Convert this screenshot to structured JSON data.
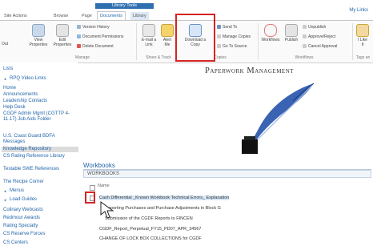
{
  "tabs": {
    "library_tools": "Library Tools",
    "site_actions": "Site Actions",
    "browse": "Browse",
    "page": "Page",
    "documents": "Documents",
    "library": "Library"
  },
  "user": "My Links",
  "ribbon": {
    "out": "Out",
    "view_properties": [
      "View",
      "Properties"
    ],
    "edit_properties": [
      "Edit",
      "Properties"
    ],
    "version_history": "Version History",
    "document_permissions": "Document Permissions",
    "delete_document": "Delete Document",
    "email_link": [
      "E-mail a",
      "Link"
    ],
    "alert_me": [
      "Alert",
      "Me"
    ],
    "download_copy": [
      "Download a",
      "Copy"
    ],
    "send_to": "Send To",
    "manage_copies": "Manage Copies",
    "go_to_source": "Go To Source",
    "workflows": "Workflows",
    "publish": "Publish",
    "unpublish": "Unpublish",
    "approve_reject": "Approve/Reject",
    "cancel_approval": "Cancel Approval",
    "i_like_it": [
      "I Like",
      "It"
    ],
    "groups": {
      "manage": "Manage",
      "share_track": "Share & Track",
      "copies": "Copies",
      "workflows": "Workflows",
      "tags": "Tags an"
    },
    "colors": {
      "accent": "#2f6fb0",
      "highlight": "#d42424"
    }
  },
  "leftnav": [
    {
      "label": "Lists",
      "type": "header"
    },
    {
      "label": "RPQ Video Links",
      "type": "sub"
    },
    {
      "label": "Home",
      "type": "item"
    },
    {
      "label": "Announcements",
      "type": "item"
    },
    {
      "label": "Leadership Contacts",
      "type": "item"
    },
    {
      "label": "Help Desk",
      "type": "item"
    },
    {
      "label": "CGDF Admin Mgmt (CGTTP 4-11.17) Job Aids Folder",
      "type": "item"
    },
    {
      "label": "U.S. Coast Guard BDFA Messages",
      "type": "item"
    },
    {
      "label": "Knowledge Repository",
      "type": "active"
    },
    {
      "label": "CS Rating Reference Library",
      "type": "item"
    },
    {
      "label": "Testable SWE References",
      "type": "item"
    },
    {
      "label": "The Recipe Corner",
      "type": "item"
    },
    {
      "label": "Menus",
      "type": "sub"
    },
    {
      "label": "Load Guides",
      "type": "sub"
    },
    {
      "label": "Culinary Webcasts",
      "type": "item"
    },
    {
      "label": "Redmour Awards",
      "type": "item"
    },
    {
      "label": "Rating Specialty",
      "type": "item"
    },
    {
      "label": "CS Reserve Forces",
      "type": "item"
    },
    {
      "label": "CS Centers",
      "type": "item"
    }
  ],
  "main": {
    "title": "Paperwork Management",
    "workbooks_heading": "Workbooks",
    "workbooks_box": "WORKBOOKS",
    "name_header": "Name",
    "rows": [
      "Cash Differential _Known Workbook Technical Errors_ Explanation",
      "Reporting Purchases and Purchase Adjustments in Block G",
      "Submission of the CGDF Reports to FINCEN",
      "CGDF_Report_Perpetual_FY15_PD07_APR_34567",
      "CHANGE OF LOCK BOX COLLECTIONS for CGDF"
    ]
  }
}
